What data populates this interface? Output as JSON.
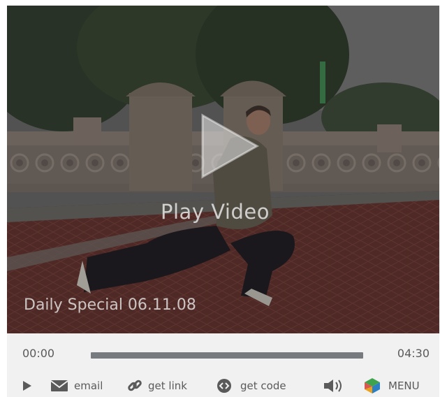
{
  "video": {
    "play_label": "Play Video",
    "title": "Daily Special 06.11.08",
    "progress": 0
  },
  "controls": {
    "current_time": "00:00",
    "total_time": "04:30"
  },
  "toolbar": {
    "email_label": "email",
    "link_label": "get link",
    "code_label": "get code",
    "menu_label": "MENU"
  },
  "colors": {
    "control_bg": "#f1f1f1",
    "progress_bar": "#777a7f",
    "control_text": "#5a5a5a"
  },
  "icons": [
    "play-icon",
    "email-icon",
    "link-icon",
    "code-icon",
    "volume-icon",
    "menu-icon"
  ]
}
